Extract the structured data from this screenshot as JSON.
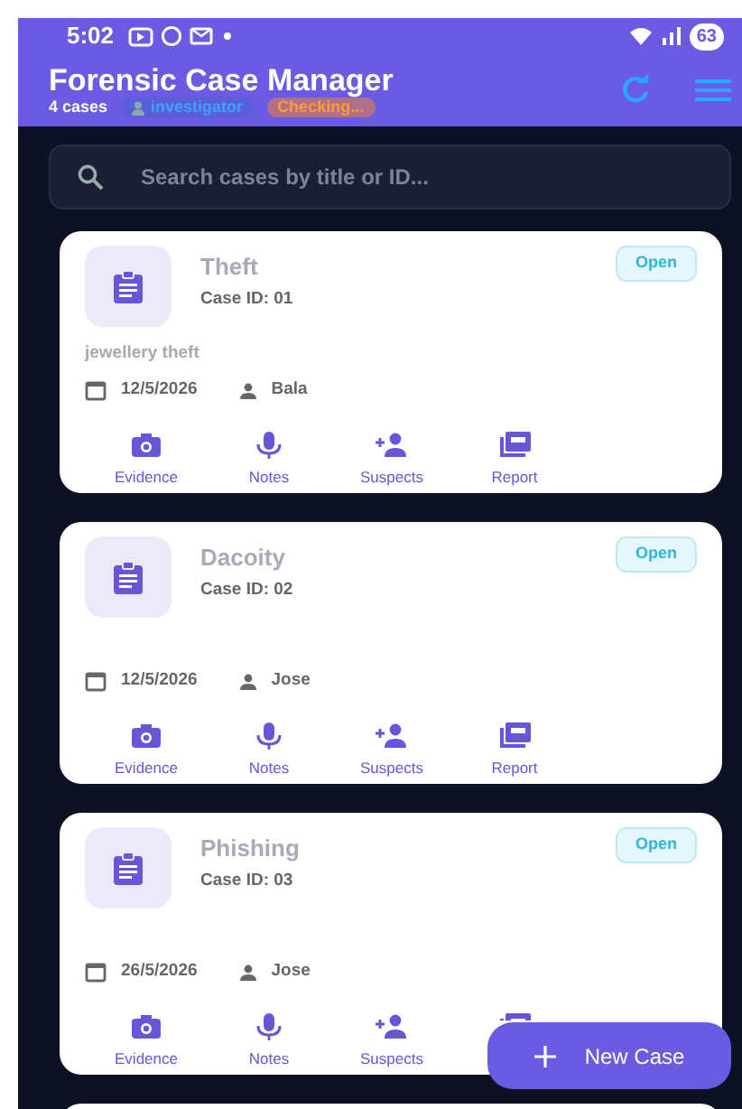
{
  "status_bar": {
    "time": "5:02",
    "battery": "63"
  },
  "header": {
    "title": "Forensic Case Manager",
    "count": "4 cases",
    "role": "investigator",
    "sync": "Checking..."
  },
  "search": {
    "placeholder": "Search cases by title or ID..."
  },
  "cases": [
    {
      "title": "Theft",
      "case_id": "Case ID: 01",
      "status": "Open",
      "description": "jewellery theft",
      "date": "12/5/2026",
      "officer": "Bala",
      "actions": [
        {
          "kind": "evidence",
          "label": "Evidence"
        },
        {
          "kind": "notes",
          "label": "Notes"
        },
        {
          "kind": "suspects",
          "label": "Suspects"
        },
        {
          "kind": "report",
          "label": "Report"
        }
      ]
    },
    {
      "title": "Dacoity",
      "case_id": "Case ID: 02",
      "status": "Open",
      "date": "12/5/2026",
      "officer": "Jose",
      "actions": [
        {
          "kind": "evidence",
          "label": "Evidence"
        },
        {
          "kind": "notes",
          "label": "Notes"
        },
        {
          "kind": "suspects",
          "label": "Suspects"
        },
        {
          "kind": "report",
          "label": "Report"
        }
      ]
    },
    {
      "title": "Phishing",
      "case_id": "Case ID: 03",
      "status": "Open",
      "date": "26/5/2026",
      "officer": "Jose",
      "actions": [
        {
          "kind": "evidence",
          "label": "Evidence"
        },
        {
          "kind": "notes",
          "label": "Notes"
        },
        {
          "kind": "suspects",
          "label": "Suspects"
        },
        {
          "kind": "report"
        }
      ]
    }
  ],
  "fab": {
    "label": "New Case"
  }
}
